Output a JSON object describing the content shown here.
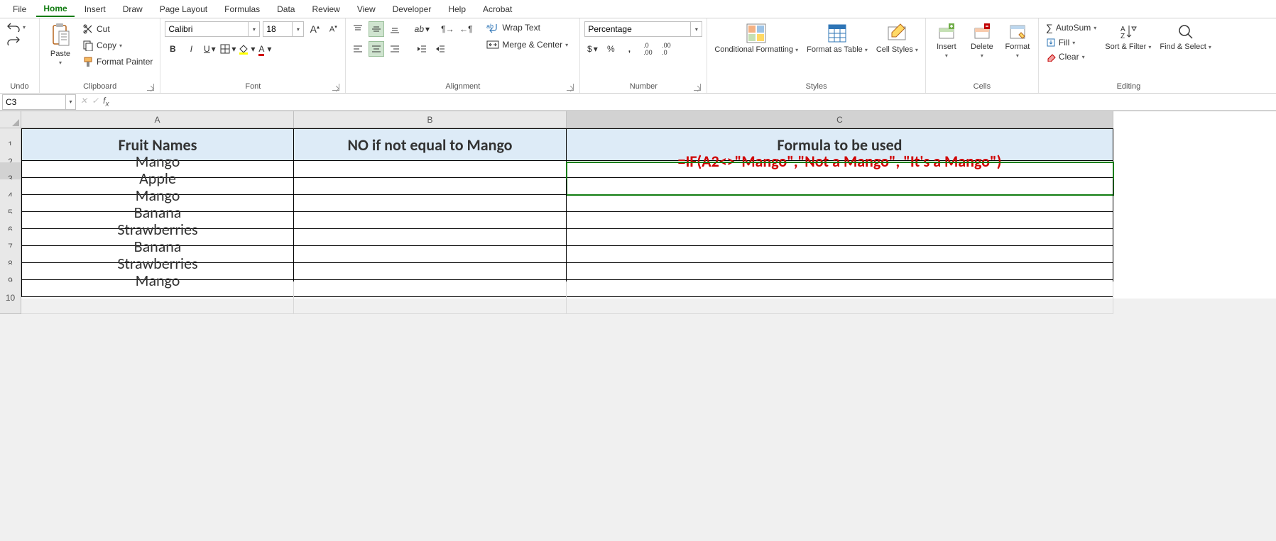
{
  "menubar": {
    "tabs": [
      "File",
      "Home",
      "Insert",
      "Draw",
      "Page Layout",
      "Formulas",
      "Data",
      "Review",
      "View",
      "Developer",
      "Help",
      "Acrobat"
    ],
    "active": "Home"
  },
  "ribbon": {
    "undo_group": "Undo",
    "clipboard": {
      "paste": "Paste",
      "cut": "Cut",
      "copy": "Copy",
      "format_painter": "Format Painter",
      "label": "Clipboard"
    },
    "font": {
      "name": "Calibri",
      "size": "18",
      "label": "Font"
    },
    "alignment": {
      "wrap": "Wrap Text",
      "merge": "Merge & Center",
      "label": "Alignment"
    },
    "number": {
      "format": "Percentage",
      "label": "Number"
    },
    "styles": {
      "cond": "Conditional Formatting",
      "table": "Format as Table",
      "cell": "Cell Styles",
      "label": "Styles"
    },
    "cells": {
      "insert": "Insert",
      "delete": "Delete",
      "format": "Format",
      "label": "Cells"
    },
    "editing": {
      "autosum": "AutoSum",
      "fill": "Fill",
      "clear": "Clear",
      "sort": "Sort & Filter",
      "find": "Find & Select",
      "label": "Editing"
    }
  },
  "namebox": "C3",
  "formula": "",
  "columns": [
    "A",
    "B",
    "C"
  ],
  "rows": [
    "1",
    "2",
    "3",
    "4",
    "5",
    "6",
    "7",
    "8",
    "9",
    "10"
  ],
  "chart_data": {
    "type": "table",
    "headers": [
      "Fruit Names",
      "NO if not equal to Mango",
      "Formula to be used"
    ],
    "rows": [
      [
        "Mango",
        "",
        "=IF(A2<>\"Mango\",\"Not a Mango\", \"It's a Mango\")"
      ],
      [
        "Apple",
        "",
        ""
      ],
      [
        "Mango",
        "",
        ""
      ],
      [
        "Banana",
        "",
        ""
      ],
      [
        "Strawberries",
        "",
        ""
      ],
      [
        "Banana",
        "",
        ""
      ],
      [
        "Strawberries",
        "",
        ""
      ],
      [
        "Mango",
        "",
        ""
      ]
    ]
  },
  "active_cell": "C3"
}
